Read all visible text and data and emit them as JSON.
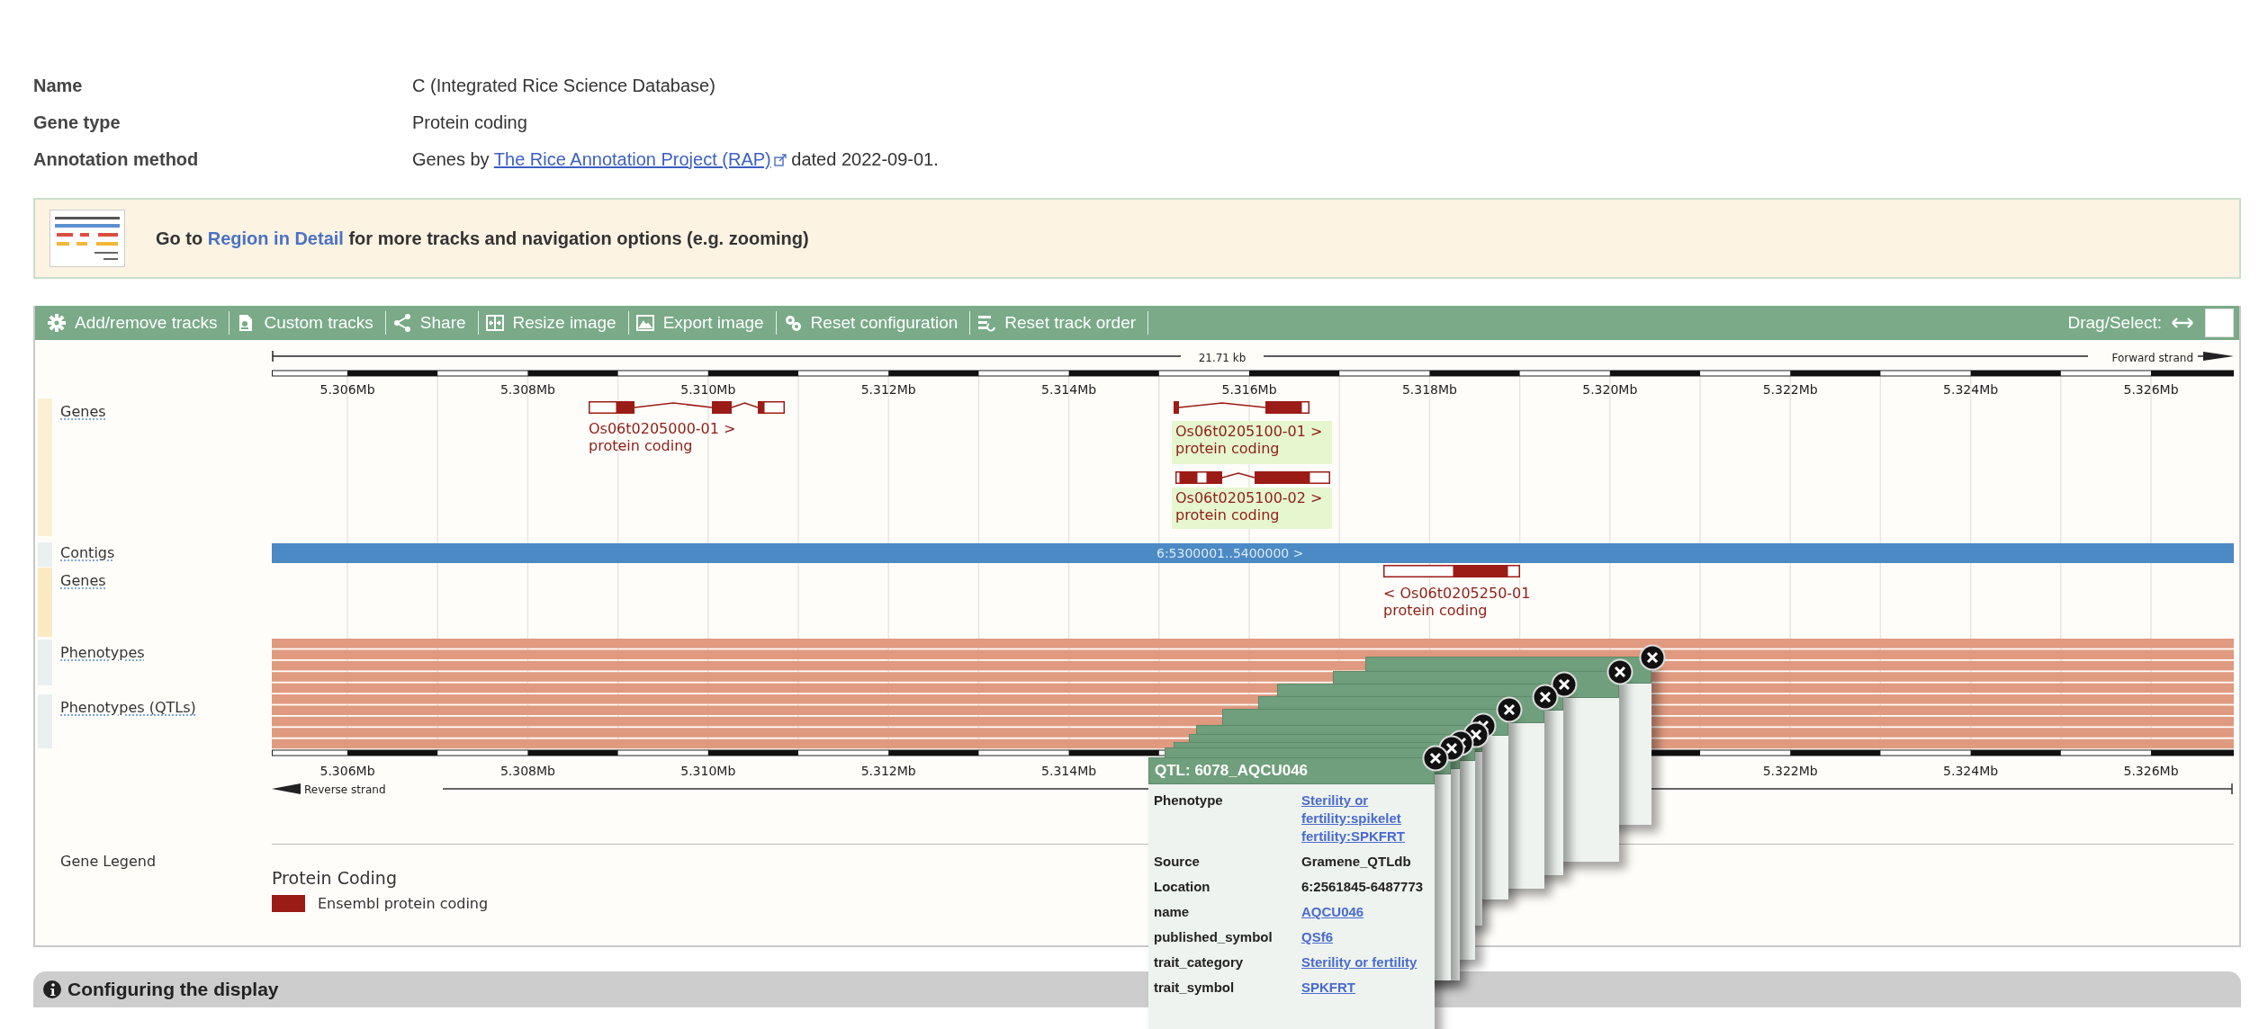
{
  "summary": [
    {
      "label": "Name",
      "kind": "text",
      "value": "C (Integrated Rice Science Database)"
    },
    {
      "label": "Gene type",
      "kind": "text",
      "value": "Protein coding"
    },
    {
      "label": "Annotation method",
      "kind": "link",
      "before": "Genes by",
      "link": "The Rice Annotation Project (RAP)",
      "after": "dated 2022-09-01."
    }
  ],
  "banner": {
    "before": "Go to",
    "link": "Region in Detail",
    "after": "for more tracks and navigation options (e.g. zooming)"
  },
  "toolbar": {
    "items": [
      {
        "label": "Add/remove tracks",
        "kind": "tracks"
      },
      {
        "label": "Custom tracks",
        "kind": "custom"
      },
      {
        "label": "Share",
        "kind": "share"
      },
      {
        "label": "Resize image",
        "kind": "resize"
      },
      {
        "label": "Export image",
        "kind": "export"
      },
      {
        "label": "Reset configuration",
        "kind": "reset_config"
      },
      {
        "label": "Reset track order",
        "kind": "reset_order"
      }
    ],
    "drag_label": "Drag/Select:",
    "select_mode": false
  },
  "ruler_top": {
    "scale": "21.71 kb",
    "strand": "Forward strand",
    "ticks": [
      "5.306Mb",
      "5.308Mb",
      "5.310Mb",
      "5.312Mb",
      "5.314Mb",
      "5.316Mb",
      "5.318Mb",
      "5.320Mb",
      "5.322Mb",
      "5.324Mb",
      "5.326Mb"
    ]
  },
  "tracks": [
    {
      "label": "Genes",
      "kind": "genes",
      "features": [
        {
          "name": "Os06t0205000-01 >",
          "biotype": "protein coding",
          "highlighted": false
        },
        {
          "name": "Os06t0205100-01 >",
          "biotype": "protein coding",
          "highlighted": true
        },
        {
          "name": "Os06t0205100-02 >",
          "biotype": "protein coding",
          "highlighted": true
        }
      ]
    },
    {
      "label": "Contigs",
      "kind": "contigs",
      "feature": "6:5300001..5400000 >"
    },
    {
      "label": "Genes",
      "kind": "genes",
      "features": [
        {
          "name": "< Os06t0205250-01",
          "biotype": "protein coding",
          "highlighted": false
        }
      ]
    },
    {
      "label": "Phenotypes",
      "kind": "phenotypes"
    },
    {
      "label": "Phenotypes (QTLs)",
      "kind": "phenotypes"
    }
  ],
  "ruler_bottom": {
    "strand": "Reverse strand",
    "ticks": [
      "5.306Mb",
      "5.308Mb",
      "5.310Mb",
      "5.312Mb",
      "5.314Mb",
      "5.322Mb",
      "5.324Mb",
      "5.326Mb"
    ]
  },
  "legend": {
    "title": "Gene Legend",
    "group": "Protein Coding",
    "items": [
      {
        "label": "Ensembl protein coding",
        "color": "#9b1b17"
      }
    ]
  },
  "qtl_popups": {
    "stacked": [
      {
        "closable": true
      },
      {
        "closable": true
      },
      {
        "closable": true
      },
      {
        "closable": true
      },
      {
        "closable": true
      },
      {
        "closable": true
      },
      {
        "closable": true
      },
      {
        "closable": true
      },
      {
        "closable": true
      }
    ],
    "front": {
      "title": "QTL: 6078_AQCU046",
      "closable": true,
      "rows": [
        {
          "label": "Phenotype",
          "value": "Sterility or fertility:spikelet fertility:SPKFRT",
          "link": true
        },
        {
          "label": "Source",
          "value": "Gramene_QTLdb",
          "link": false
        },
        {
          "label": "Location",
          "value": "6:2561845-6487773",
          "link": false
        },
        {
          "label": "name",
          "value": "AQCU046",
          "link": true
        },
        {
          "label": "published_symbol",
          "value": "QSf6",
          "link": true
        },
        {
          "label": "trait_category",
          "value": "Sterility or fertility",
          "link": true
        },
        {
          "label": "trait_symbol",
          "value": "SPKFRT",
          "link": true
        }
      ]
    }
  },
  "section": {
    "title": "Configuring the display"
  }
}
